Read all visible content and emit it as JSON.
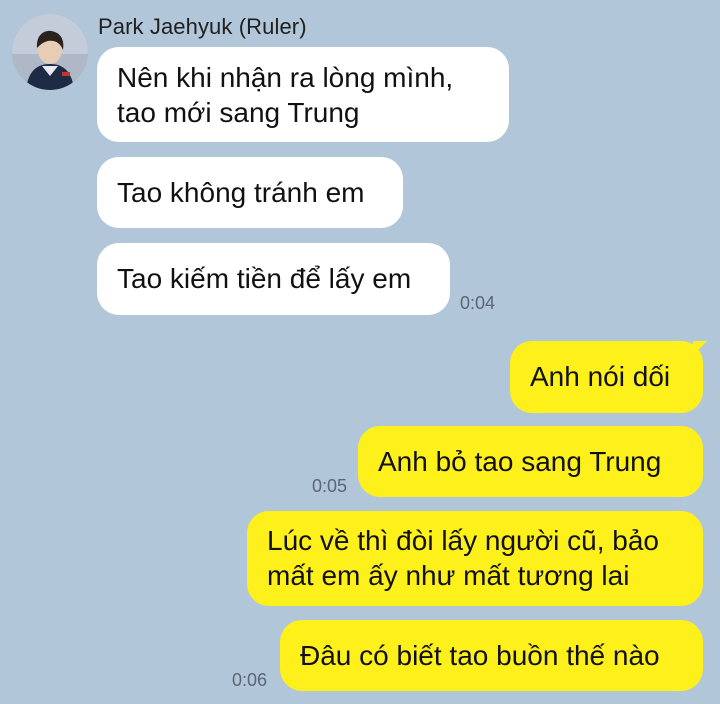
{
  "conversation": {
    "sender_name": "Park Jaehyuk (Ruler)",
    "incoming": [
      {
        "lines": [
          "Nên khi nhận ra lòng mình,",
          "tao mới sang Trung"
        ]
      },
      {
        "lines": [
          "Tao không tránh em"
        ]
      },
      {
        "lines": [
          "Tao kiếm tiền để lấy em"
        ],
        "time": "0:04"
      }
    ],
    "outgoing": [
      {
        "lines": [
          "Anh nói dối"
        ]
      },
      {
        "lines": [
          "Anh bỏ tao sang Trung"
        ],
        "time": "0:05"
      },
      {
        "lines": [
          "Lúc về thì đòi lấy người cũ, bảo",
          "mất em ấy như mất tương lai"
        ]
      },
      {
        "lines": [
          "Đâu có biết tao buồn thế nào"
        ],
        "time": "0:06"
      }
    ]
  },
  "colors": {
    "background": "#b2c6da",
    "incoming_bubble": "#ffffff",
    "outgoing_bubble": "#fef01b"
  },
  "avatar": {
    "icon": "profile-photo"
  }
}
